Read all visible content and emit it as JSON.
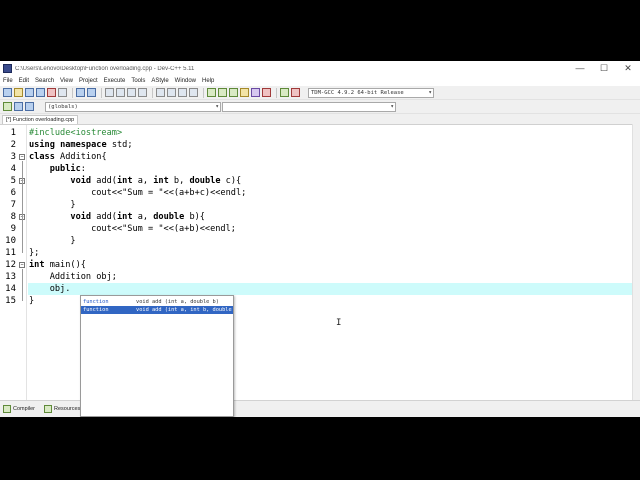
{
  "window": {
    "title": "C:\\Users\\Lenovo\\Desktop\\Function overloading.cpp - Dev-C++ 5.11",
    "minimize": "—",
    "maximize": "☐",
    "close": "✕"
  },
  "menu": [
    "File",
    "Edit",
    "Search",
    "View",
    "Project",
    "Execute",
    "Tools",
    "AStyle",
    "Window",
    "Help"
  ],
  "toolbar": {
    "compiler": "TDM-GCC 4.9.2 64-bit Release",
    "scope": "(globals)",
    "symbol": ""
  },
  "tab": {
    "label": "[*] Function overloading.cpp"
  },
  "editor": {
    "line_numbers": [
      "1",
      "2",
      "3",
      "4",
      "5",
      "6",
      "7",
      "8",
      "9",
      "10",
      "11",
      "12",
      "13",
      "14",
      "15"
    ],
    "lines": [
      {
        "t": "#include<iostream>"
      },
      {
        "t": "using namespace std;"
      },
      {
        "t": "class Addition{"
      },
      {
        "t": "    public:"
      },
      {
        "t": "        void add(int a, int b, double c){"
      },
      {
        "t": "            cout<<\"Sum = \"<<(a+b+c)<<endl;"
      },
      {
        "t": "        }"
      },
      {
        "t": "        void add(int a, double b){"
      },
      {
        "t": "            cout<<\"Sum = \"<<(a+b)<<endl;"
      },
      {
        "t": "        }"
      },
      {
        "t": "};"
      },
      {
        "t": "int main(){"
      },
      {
        "t": "    Addition obj;"
      },
      {
        "t": "    obj."
      },
      {
        "t": "}"
      }
    ],
    "current_line": 14
  },
  "autocomplete": {
    "items": [
      {
        "kind": "function",
        "signature": "void add (int a, double b)"
      },
      {
        "kind": "function",
        "signature": "void add (int a, int b, double c)"
      }
    ],
    "selected": 1
  },
  "bottom_tabs": [
    "Compiler",
    "Resources"
  ],
  "colors": {
    "current_line": "#cdfbfb",
    "preprocessor": "#2a8b38",
    "selection": "#3166c3",
    "brace": "#e03030"
  }
}
